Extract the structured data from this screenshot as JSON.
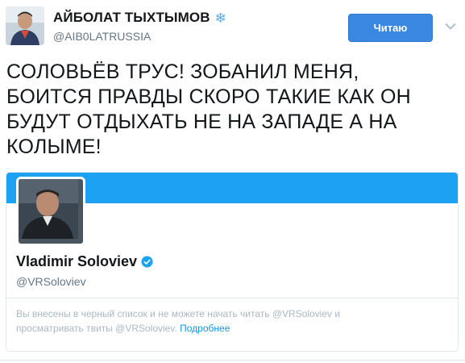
{
  "tweet": {
    "author": {
      "name": "АЙБОЛАТ ТЫХТЫМОВ",
      "badge_glyph": "❄",
      "handle": "@AIB0LATRUSSIA"
    },
    "follow_button_label": "Читаю",
    "text_lines": [
      "СОЛОВЬЁВ ТРУС! ЗОБАНИЛ МЕНЯ,",
      "БОИТСЯ ПРАВДЫ СКОРО ТАКИЕ КАК ОН",
      "БУДУТ ОТДЫХАТЬ НЕ НА ЗАПАДЕ А НА",
      "КОЛЫМЕ!"
    ]
  },
  "quoted_profile": {
    "name": "Vladimir Soloviev",
    "handle": "@VRSoloviev",
    "blocked_notice_line1": "Вы внесены в черный список и не можете начать читать @VRSoloviev и",
    "blocked_notice_line2": "просматривать твиты @VRSoloviev.",
    "more_link": "Подробнее"
  },
  "colors": {
    "accent": "#1da1f2",
    "follow_button": "#3b88e3",
    "link": "#1b95e0",
    "muted_text": "#657786",
    "notice_text": "#aab8c2"
  },
  "icons": {
    "author_badge": "snowflake-icon",
    "verified": "verified-badge-icon",
    "caret": "chevron-down-icon"
  }
}
